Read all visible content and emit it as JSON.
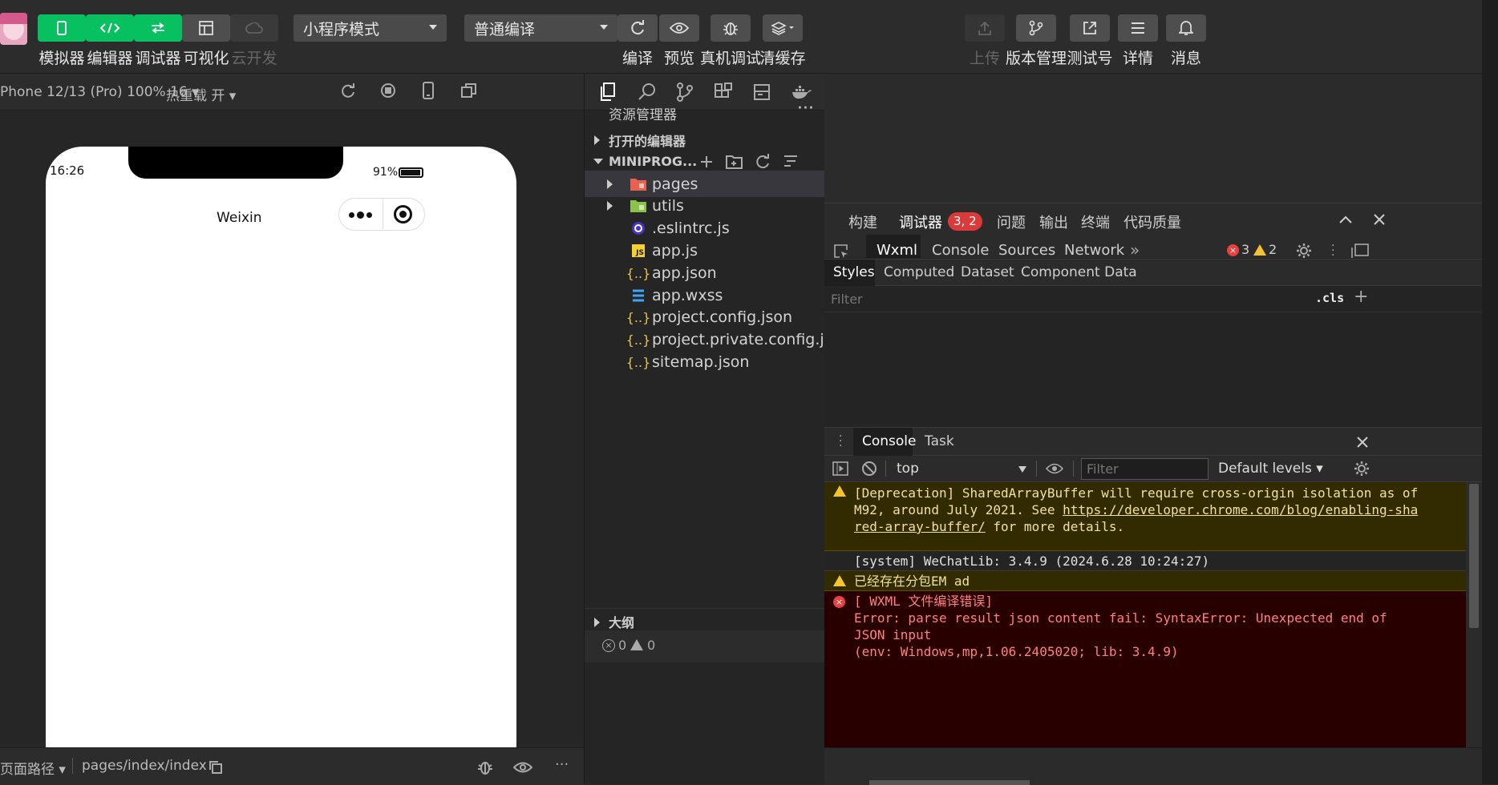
{
  "toolbar": {
    "simulator_label": "模拟器",
    "editor_label": "编辑器",
    "debugger_label": "调试器",
    "visual_label": "可视化",
    "cloud_label": "云开发",
    "mode_select": "小程序模式",
    "compile_select": "普通编译",
    "compile_label": "编译",
    "preview_label": "预览",
    "realdevice_label": "真机调试",
    "clearcache_label": "清缓存",
    "upload_label": "上传",
    "version_label": "版本管理",
    "testid_label": "测试号",
    "details_label": "详情",
    "messages_label": "消息"
  },
  "simulator": {
    "device": "Phone 12/13 (Pro) 100% 16 ▾",
    "hotreload": "热重载 开 ▾",
    "status_time": "16:26",
    "battery": "91%",
    "page_title": "Weixin",
    "path_label": "页面路径 ▾",
    "path": "pages/index/index"
  },
  "explorer": {
    "title": "资源管理器",
    "more": "···",
    "open_editors": "打开的编辑器",
    "project": "MINIPROG...",
    "files": [
      {
        "name": "pages",
        "icon": "folder-pages-icon"
      },
      {
        "name": "utils",
        "icon": "folder-utils-icon"
      },
      {
        "name": ".eslintrc.js",
        "icon": "eslint-icon"
      },
      {
        "name": "app.js",
        "icon": "js-icon"
      },
      {
        "name": "app.json",
        "icon": "json-icon"
      },
      {
        "name": "app.wxss",
        "icon": "css-icon"
      },
      {
        "name": "project.config.json",
        "icon": "json-icon"
      },
      {
        "name": "project.private.config.js...",
        "icon": "json-icon"
      },
      {
        "name": "sitemap.json",
        "icon": "json-icon"
      }
    ],
    "outline": "大纲",
    "status_errors": "0",
    "status_warnings": "0"
  },
  "devtools": {
    "top_tabs": [
      "构建",
      "调试器",
      "问题",
      "输出",
      "终端",
      "代码质量"
    ],
    "debugger_badge": "3, 2",
    "panel_tabs": [
      "Wxml",
      "Console",
      "Sources",
      "Network"
    ],
    "error_count": "3",
    "warning_count": "2",
    "style_tabs": [
      "Styles",
      "Computed",
      "Dataset",
      "Component Data"
    ],
    "filter_placeholder": "Filter",
    "cls": ".cls",
    "plus": "+",
    "drawer_tabs": [
      "Console",
      "Task"
    ],
    "context": "top",
    "console_filter": "Filter",
    "levels": "Default levels ▾",
    "messages": {
      "dep_1": "[Deprecation] SharedArrayBuffer will require cross-origin isolation as of",
      "dep_2a": "M92, around July 2021. See ",
      "dep_link_1": "https://developer.chrome.com/blog/enabling-sha",
      "dep_link_2": "red-array-buffer/",
      "dep_3": " for more details.",
      "system": "[system] WeChatLib: 3.4.9 (2024.6.28 10:24:27)",
      "warn_pkg": "已经存在分包EM ad",
      "err_1": "[ WXML 文件编译错误]",
      "err_2": "Error: parse result json content fail: SyntaxError: Unexpected end of",
      "err_3": "JSON input",
      "err_4": "(env: Windows,mp,1.06.2405020; lib: 3.4.9)"
    }
  },
  "colors": {
    "accent": "#07c160",
    "error": "#e84040",
    "warning": "#f4c430",
    "badge": "#d93a3a"
  }
}
